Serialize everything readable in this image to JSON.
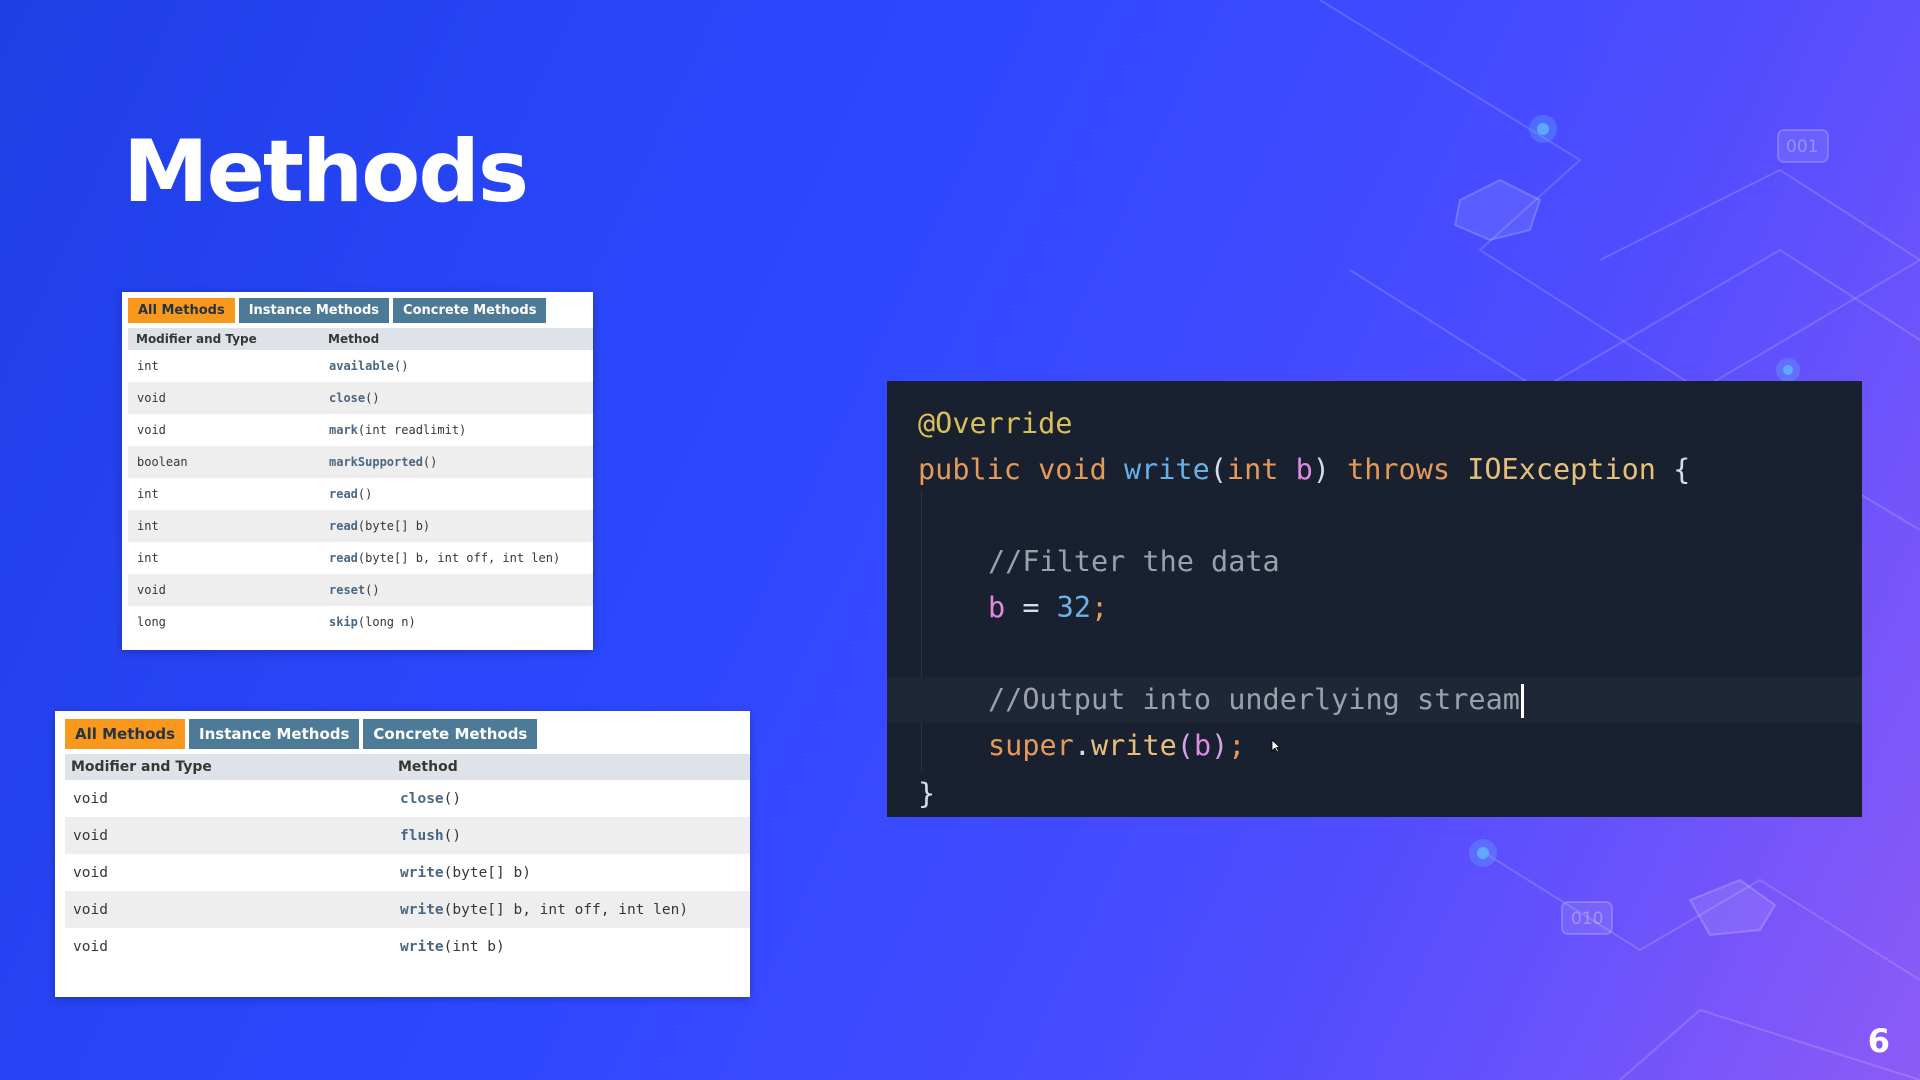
{
  "slide": {
    "title": "Methods",
    "page_number": "6",
    "deco_labels": [
      "001",
      "010"
    ]
  },
  "table_top": {
    "tabs": [
      {
        "label": "All Methods",
        "active": true
      },
      {
        "label": "Instance Methods",
        "active": false
      },
      {
        "label": "Concrete Methods",
        "active": false
      }
    ],
    "headers": [
      "Modifier and Type",
      "Method"
    ],
    "rows": [
      {
        "type": "int",
        "name": "available",
        "args": "()"
      },
      {
        "type": "void",
        "name": "close",
        "args": "()"
      },
      {
        "type": "void",
        "name": "mark",
        "args": "(int readlimit)"
      },
      {
        "type": "boolean",
        "name": "markSupported",
        "args": "()"
      },
      {
        "type": "int",
        "name": "read",
        "args": "()"
      },
      {
        "type": "int",
        "name": "read",
        "args": "(byte[] b)"
      },
      {
        "type": "int",
        "name": "read",
        "args": "(byte[] b, int off, int len)"
      },
      {
        "type": "void",
        "name": "reset",
        "args": "()"
      },
      {
        "type": "long",
        "name": "skip",
        "args": "(long n)"
      }
    ]
  },
  "table_bottom": {
    "tabs": [
      {
        "label": "All Methods",
        "active": true
      },
      {
        "label": "Instance Methods",
        "active": false
      },
      {
        "label": "Concrete Methods",
        "active": false
      }
    ],
    "headers": [
      "Modifier and Type",
      "Method"
    ],
    "rows": [
      {
        "type": "void",
        "name": "close",
        "args": "()"
      },
      {
        "type": "void",
        "name": "flush",
        "args": "()"
      },
      {
        "type": "void",
        "name": "write",
        "args": "(byte[] b)"
      },
      {
        "type": "void",
        "name": "write",
        "args": "(byte[] b, int off, int len)"
      },
      {
        "type": "void",
        "name": "write",
        "args": "(int b)"
      }
    ]
  },
  "code": {
    "annotation": "@Override",
    "kw_public": "public",
    "kw_void": "void",
    "method_name": "write",
    "param_type": "int",
    "param_name": "b",
    "kw_throws": "throws",
    "exception": "IOException",
    "open_brace": "{",
    "comment_filter": "//Filter the data",
    "assign_var": "b",
    "assign_op": " = ",
    "assign_value": "32",
    "semicolon": ";",
    "comment_output": "//Output into underlying stream",
    "super_kw": "super",
    "super_call": "write",
    "super_arg": "b",
    "close_brace": "}"
  },
  "colors": {
    "tab_active": "#f8981d",
    "tab_inactive": "#4d7a97",
    "editor_bg": "#19202f",
    "slide_gradient": [
      "#1f3fe6",
      "#8d5bf7"
    ]
  }
}
